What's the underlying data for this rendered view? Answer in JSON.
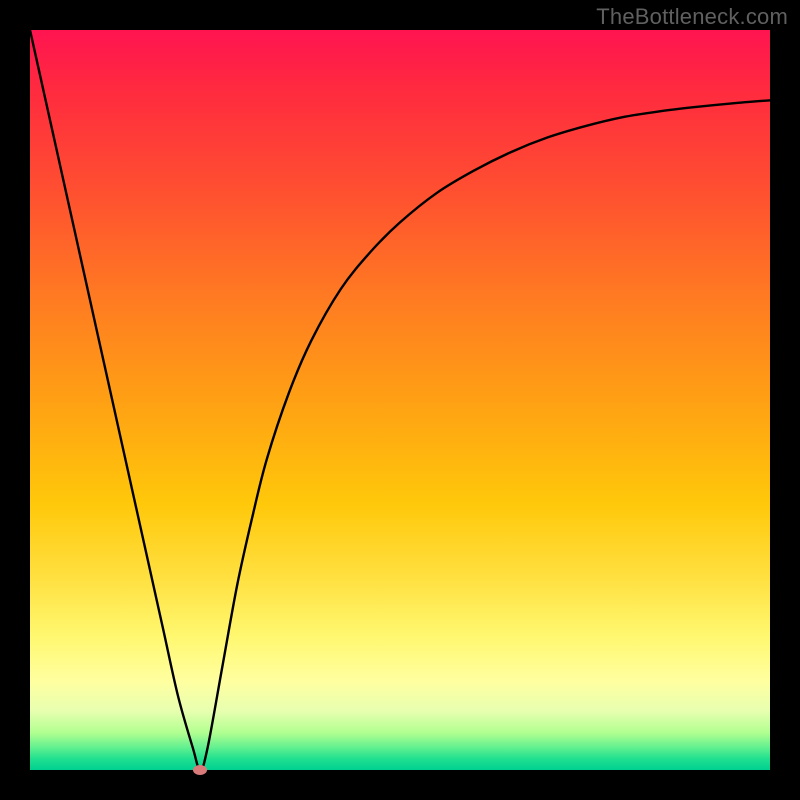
{
  "watermark": "TheBottleneck.com",
  "chart_data": {
    "type": "line",
    "title": "",
    "xlabel": "",
    "ylabel": "",
    "xlim": [
      0,
      100
    ],
    "ylim": [
      0,
      100
    ],
    "grid": false,
    "legend": false,
    "series": [
      {
        "name": "bottleneck-curve",
        "x": [
          0,
          2,
          4,
          6,
          8,
          10,
          12,
          14,
          16,
          18,
          20,
          22,
          23,
          24,
          26,
          28,
          30,
          32,
          35,
          38,
          42,
          46,
          50,
          55,
          60,
          65,
          70,
          75,
          80,
          85,
          90,
          95,
          100
        ],
        "values": [
          100,
          91,
          82,
          73,
          64,
          55,
          46,
          37,
          28,
          19,
          10,
          3,
          0,
          3,
          14,
          25,
          34,
          42,
          51,
          58,
          65,
          70,
          74,
          78,
          81,
          83.5,
          85.5,
          87,
          88.2,
          89,
          89.6,
          90.1,
          90.5
        ]
      }
    ],
    "marker": {
      "x": 23,
      "y": 0,
      "color": "#d97a7a"
    },
    "gradient_stops": [
      {
        "pos": 0,
        "color": "#ff1450"
      },
      {
        "pos": 0.08,
        "color": "#ff2a3f"
      },
      {
        "pos": 0.22,
        "color": "#ff5030"
      },
      {
        "pos": 0.36,
        "color": "#ff7a22"
      },
      {
        "pos": 0.5,
        "color": "#ffa014"
      },
      {
        "pos": 0.64,
        "color": "#ffc80a"
      },
      {
        "pos": 0.74,
        "color": "#ffe040"
      },
      {
        "pos": 0.82,
        "color": "#fff870"
      },
      {
        "pos": 0.88,
        "color": "#ffffa0"
      },
      {
        "pos": 0.92,
        "color": "#e8ffb0"
      },
      {
        "pos": 0.95,
        "color": "#b0ff90"
      },
      {
        "pos": 0.97,
        "color": "#60f090"
      },
      {
        "pos": 0.985,
        "color": "#20e090"
      },
      {
        "pos": 1.0,
        "color": "#00d090"
      }
    ]
  }
}
